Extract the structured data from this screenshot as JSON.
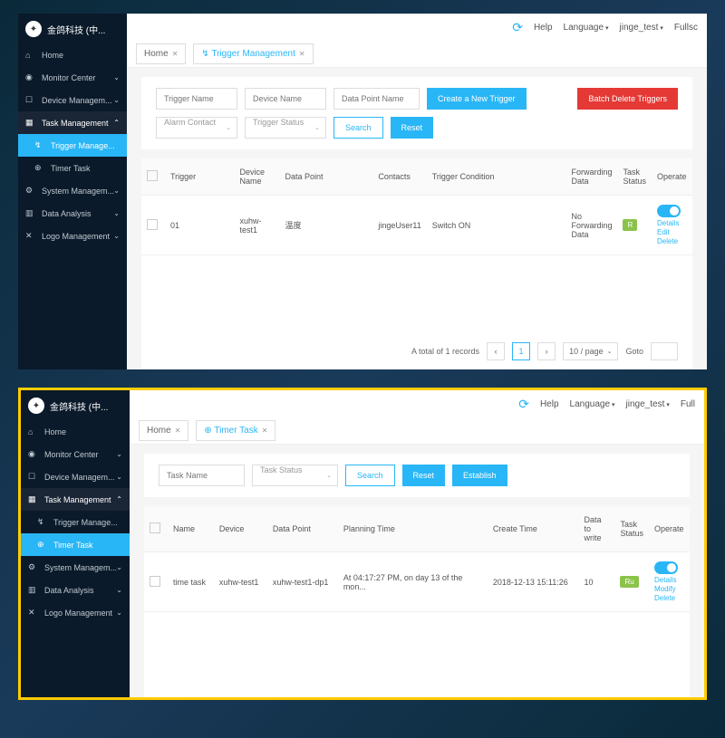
{
  "brand": "金鸽科技 (中...",
  "topbar": {
    "help": "Help",
    "language": "Language",
    "user": "jinge_test",
    "fullscreen": "Fullsc"
  },
  "sidebar": {
    "items": [
      {
        "icon": "⌂",
        "label": "Home"
      },
      {
        "icon": "◉",
        "label": "Monitor Center",
        "caret": true
      },
      {
        "icon": "☐",
        "label": "Device Managem...",
        "caret": true
      },
      {
        "icon": "▦",
        "label": "Task Management",
        "caret": true,
        "expand": true
      },
      {
        "icon": "↯",
        "label": "Trigger Manage...",
        "sub": true
      },
      {
        "icon": "⊕",
        "label": "Timer Task",
        "sub": true
      },
      {
        "icon": "⚙",
        "label": "System Managem...",
        "caret": true
      },
      {
        "icon": "▥",
        "label": "Data Analysis",
        "caret": true
      },
      {
        "icon": "✕",
        "label": "Logo Management",
        "caret": true
      }
    ]
  },
  "screen1": {
    "tabs": [
      {
        "label": "Home"
      },
      {
        "label": "Trigger Management",
        "icon": "↯",
        "active": true
      }
    ],
    "filters": {
      "triggerName": "Trigger Name",
      "deviceName": "Device Name",
      "dataPointName": "Data Point Name",
      "alarmContact": "Alarm Contact",
      "triggerStatus": "Trigger Status",
      "search": "Search",
      "reset": "Reset",
      "create": "Create a New Trigger",
      "batchDelete": "Batch Delete Triggers"
    },
    "headers": [
      "Trigger",
      "Device Name",
      "Data Point",
      "Contacts",
      "Trigger Condition",
      "Forwarding Data",
      "Task Status",
      "Operate"
    ],
    "row": {
      "trigger": "01",
      "device": "xuhw-test1",
      "datapoint": "温度",
      "contacts": "jingeUser11",
      "condition": "Switch ON",
      "forward": "No Forwarding Data",
      "status": "R",
      "ops": [
        "Details",
        "Edit",
        "Delete"
      ]
    },
    "pager": {
      "total": "A total of 1 records",
      "page": "1",
      "perpage": "10 / page",
      "goto": "Goto"
    }
  },
  "screen2": {
    "topbar_full": "Full",
    "tabs": [
      {
        "label": "Home"
      },
      {
        "label": "Timer Task",
        "icon": "⊕",
        "active": true
      }
    ],
    "filters": {
      "taskName": "Task Name",
      "taskStatus": "Task Status",
      "search": "Search",
      "reset": "Reset",
      "establish": "Establish"
    },
    "headers": [
      "Name",
      "Device",
      "Data Point",
      "Planning Time",
      "Create Time",
      "Data to write",
      "Task Status",
      "Operate"
    ],
    "row": {
      "name": "time task",
      "device": "xuhw-test1",
      "datapoint": "xuhw-test1-dp1",
      "planning": "At 04:17:27 PM, on day 13 of the mon...",
      "created": "2018-12-13 15:11:26",
      "datawrite": "10",
      "status": "Ru",
      "ops": [
        "Details",
        "Modify",
        "Delete"
      ]
    }
  }
}
